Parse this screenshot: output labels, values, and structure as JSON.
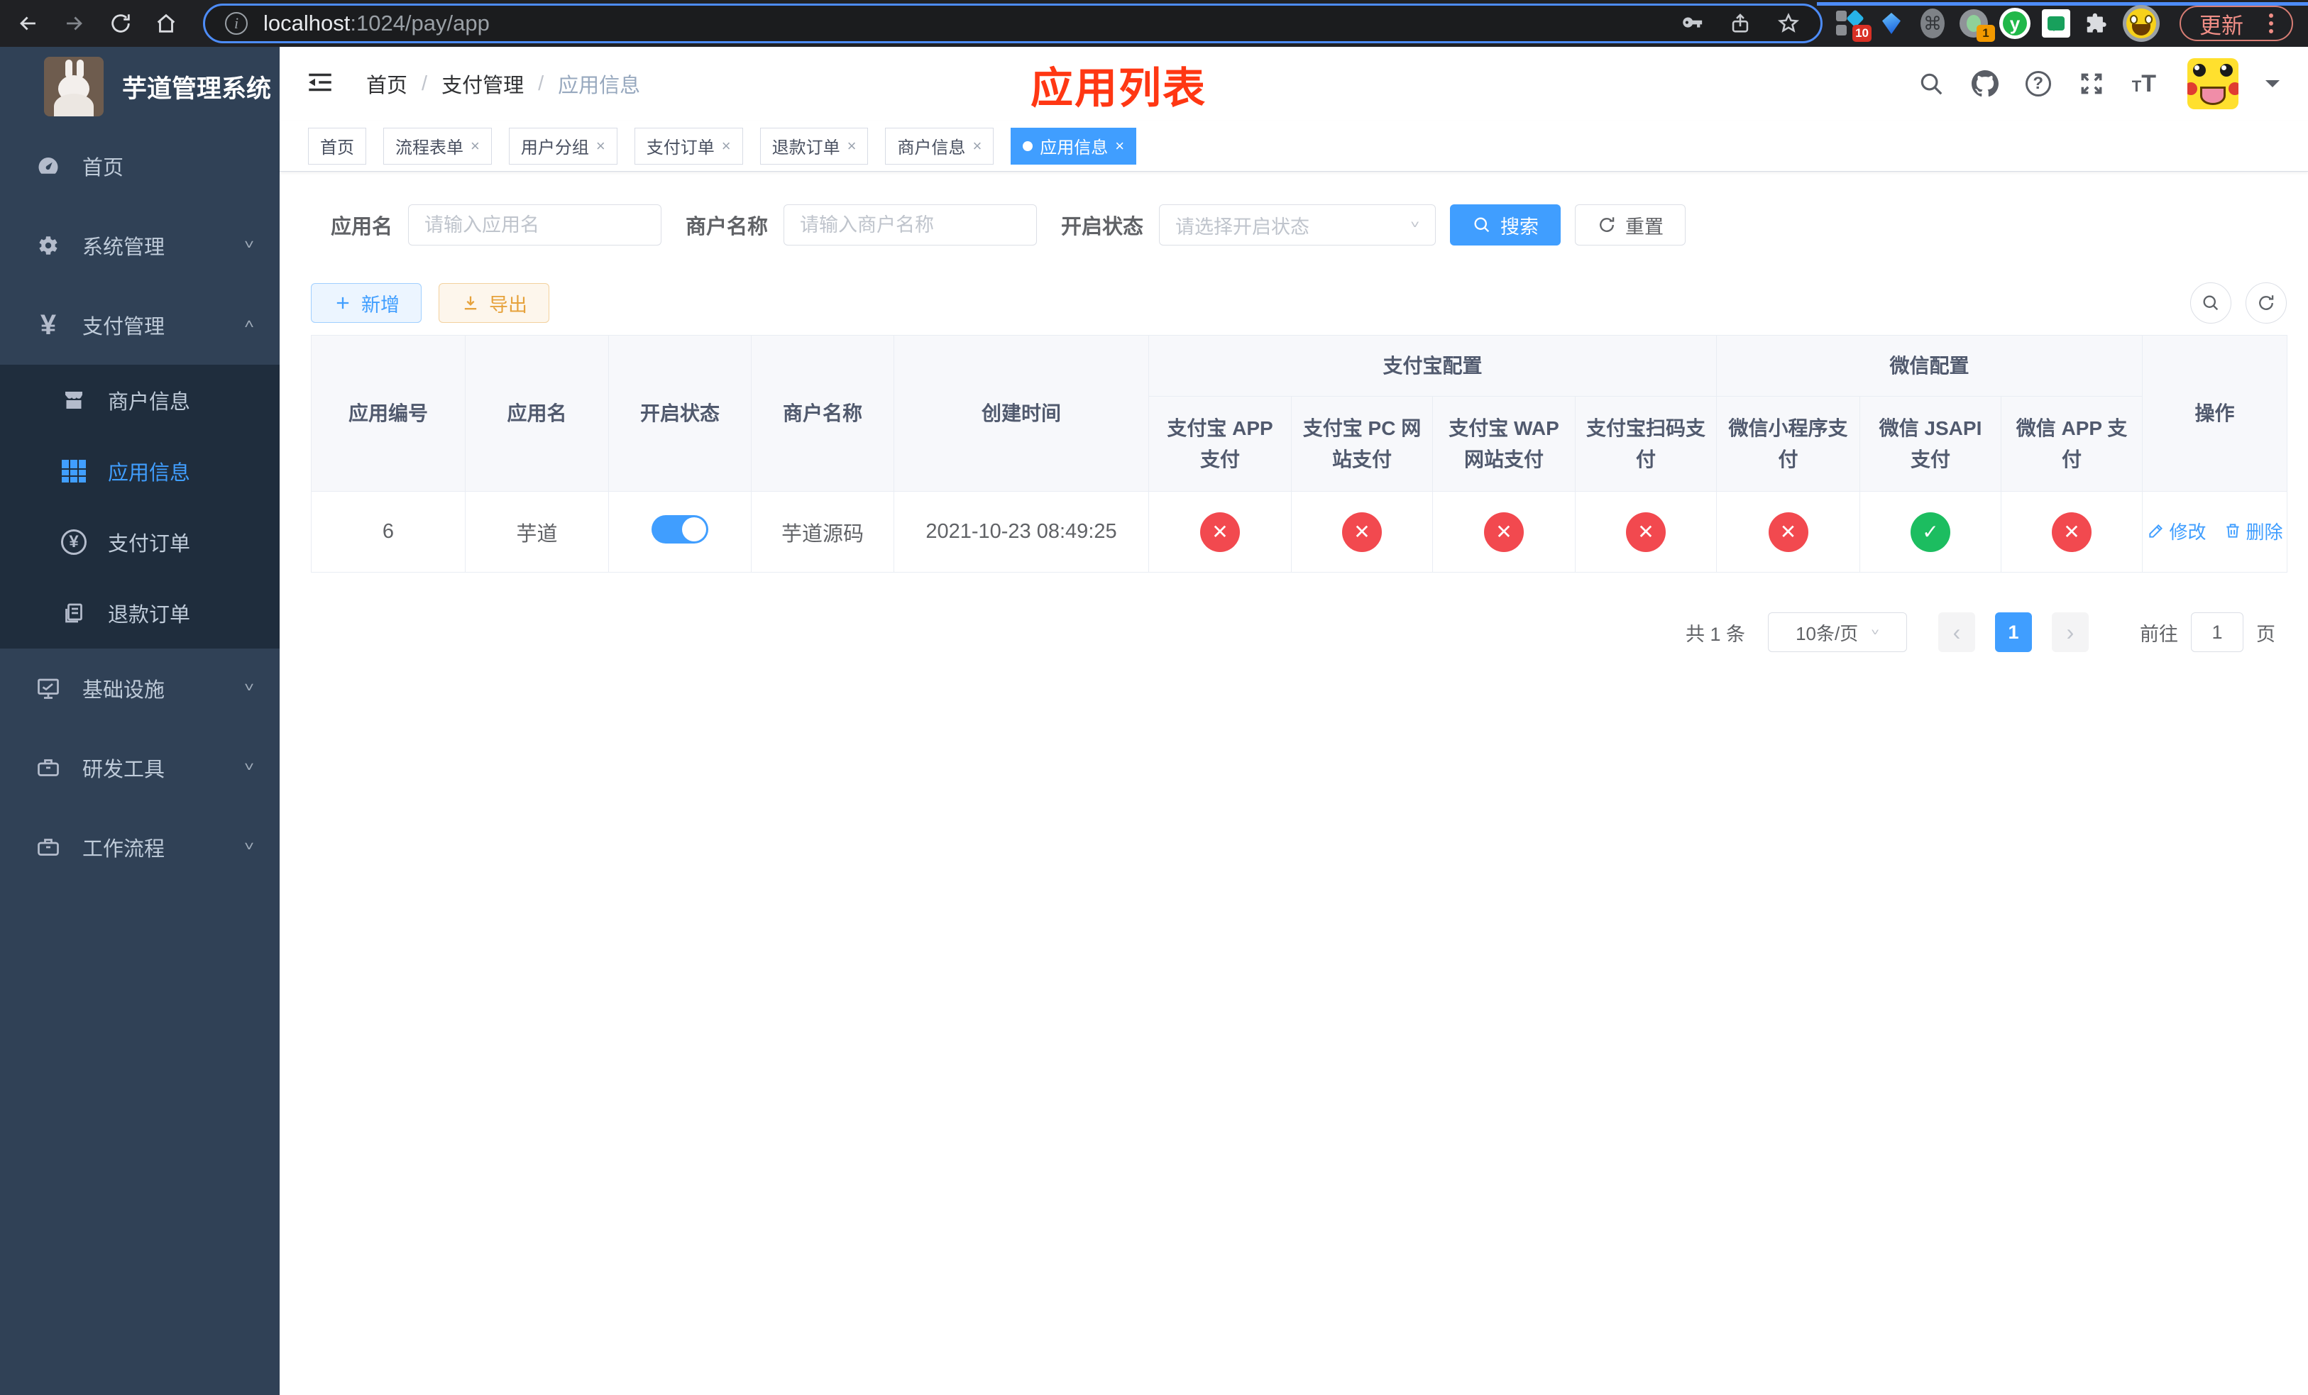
{
  "browser": {
    "url": {
      "host": "localhost",
      "rest": ":1024/pay/app"
    },
    "update_label": "更新",
    "ext_badge_blue": "10",
    "ext_badge_camera": "1",
    "ext_y_letter": "y",
    "ext_cmd_glyph": "⌘"
  },
  "annotation": {
    "title": "应用列表",
    "color": "#ff3713"
  },
  "sidebar": {
    "title": "芋道管理系统",
    "menu": [
      {
        "label": "首页"
      },
      {
        "label": "系统管理"
      },
      {
        "label": "支付管理"
      },
      {
        "label": "商户信息"
      },
      {
        "label": "应用信息"
      },
      {
        "label": "支付订单"
      },
      {
        "label": "退款订单"
      },
      {
        "label": "基础设施"
      },
      {
        "label": "研发工具"
      },
      {
        "label": "工作流程"
      }
    ]
  },
  "header": {
    "breadcrumb": [
      "首页",
      "支付管理",
      "应用信息"
    ],
    "separator": "/"
  },
  "tabs": [
    {
      "label": "首页"
    },
    {
      "label": "流程表单"
    },
    {
      "label": "用户分组"
    },
    {
      "label": "支付订单"
    },
    {
      "label": "退款订单"
    },
    {
      "label": "商户信息"
    },
    {
      "label": "应用信息"
    }
  ],
  "filters": {
    "app_name_label": "应用名",
    "app_name_placeholder": "请输入应用名",
    "merchant_label": "商户名称",
    "merchant_placeholder": "请输入商户名称",
    "status_label": "开启状态",
    "status_placeholder": "请选择开启状态",
    "search_label": "搜索",
    "reset_label": "重置"
  },
  "toolbar": {
    "add_label": "新增",
    "export_label": "导出"
  },
  "table": {
    "columns": [
      "应用编号",
      "应用名",
      "开启状态",
      "商户名称",
      "创建时间"
    ],
    "groups": [
      {
        "label": "支付宝配置",
        "children": [
          "支付宝 APP 支付",
          "支付宝 PC 网站支付",
          "支付宝 WAP 网站支付",
          "支付宝扫码支付"
        ]
      },
      {
        "label": "微信配置",
        "children": [
          "微信小程序支付",
          "微信 JSAPI 支付",
          "微信 APP 支付"
        ]
      }
    ],
    "action_column": "操作",
    "row": {
      "id": "6",
      "name": "芋道",
      "status_on": true,
      "merchant": "芋道源码",
      "created": "2021-10-23 08:49:25",
      "configs": [
        "no",
        "no",
        "no",
        "no",
        "no",
        "yes",
        "no"
      ],
      "edit_label": "修改",
      "delete_label": "删除"
    }
  },
  "pagination": {
    "total": "共 1 条",
    "page_size": "10条/页",
    "current_page": "1",
    "goto_label": "前往",
    "goto_value": "1",
    "page_suffix": "页"
  }
}
